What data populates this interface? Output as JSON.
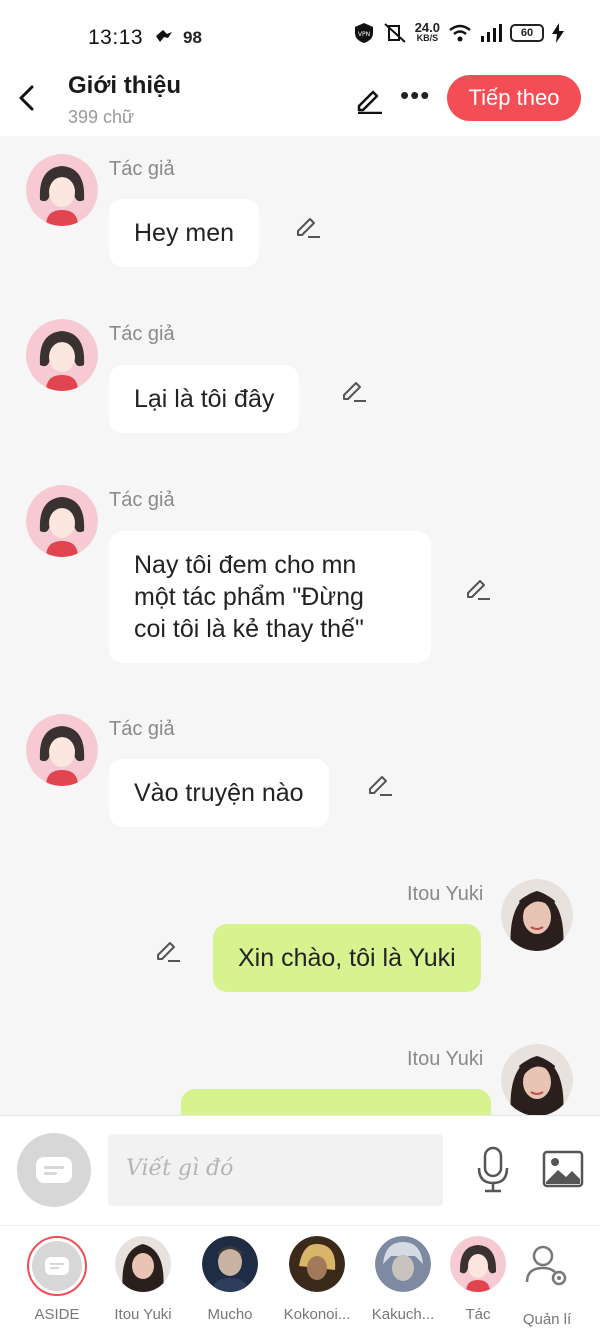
{
  "status_bar": {
    "time": "13:13",
    "notif_count": "98",
    "net_speed_value": "24.0",
    "net_speed_unit": "KB/S",
    "battery": "60"
  },
  "header": {
    "title": "Giới thiệu",
    "subtitle": "399 chữ",
    "next_label": "Tiếp theo"
  },
  "messages": [
    {
      "sender": "Tác giả",
      "text": "Hey men",
      "side": "left"
    },
    {
      "sender": "Tác giả",
      "text": "Lại là tôi đây",
      "side": "left"
    },
    {
      "sender": "Tác giả",
      "text": "Nay tôi đem cho mn\nmột tác phẩm \"Đừng\ncoi tôi là kẻ thay thế\"",
      "side": "left"
    },
    {
      "sender": "Tác giả",
      "text": "Vào truyện nào",
      "side": "left"
    },
    {
      "sender": "Itou Yuki",
      "text": "Xin chào, tôi là Yuki",
      "side": "right"
    },
    {
      "sender": "Itou Yuki",
      "text": "",
      "side": "right"
    }
  ],
  "composer": {
    "placeholder": "Viết gì đó"
  },
  "characters": [
    {
      "label": "ASIDE",
      "active": true
    },
    {
      "label": "Itou Yuki"
    },
    {
      "label": "Mucho"
    },
    {
      "label": "Kokonoi..."
    },
    {
      "label": "Kakuch..."
    },
    {
      "label": "Tác"
    },
    {
      "label": "Quản lí"
    }
  ],
  "colors": {
    "accent": "#f34d55",
    "my_bubble": "#d6f38f",
    "other_bubble": "#ffffff",
    "background": "#f6f6f6"
  }
}
